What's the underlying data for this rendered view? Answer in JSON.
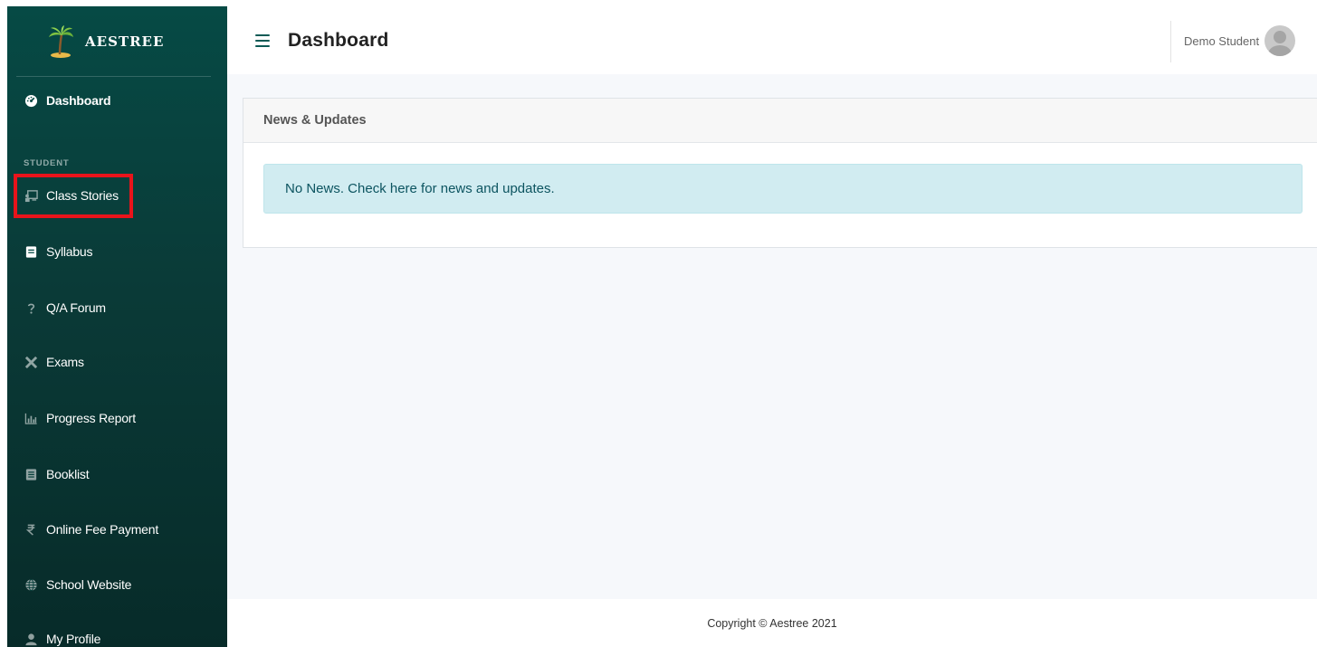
{
  "brand": {
    "name": "AESTREE",
    "logo_icon": "palm-tree-icon"
  },
  "header": {
    "title": "Dashboard",
    "user_name": "Demo Student"
  },
  "sidebar": {
    "section_heading": "STUDENT",
    "items": [
      {
        "label": "Dashboard",
        "icon": "gauge-icon",
        "active": true
      },
      {
        "label": "Class Stories",
        "icon": "chalkboard-teacher-icon"
      },
      {
        "label": "Syllabus",
        "icon": "book-icon"
      },
      {
        "label": "Q/A Forum",
        "icon": "question-icon"
      },
      {
        "label": "Exams",
        "icon": "pencil-ruler-icon"
      },
      {
        "label": "Progress Report",
        "icon": "bar-chart-icon"
      },
      {
        "label": "Booklist",
        "icon": "book-list-icon"
      },
      {
        "label": "Online Fee Payment",
        "icon": "rupee-icon"
      },
      {
        "label": "School Website",
        "icon": "globe-icon"
      },
      {
        "label": "My Profile",
        "icon": "user-icon"
      }
    ]
  },
  "main": {
    "card_title": "News & Updates",
    "alert_text": "No News. Check here for news and updates."
  },
  "footer": {
    "copyright": "Copyright © Aestree 2021"
  },
  "colors": {
    "sidebar_bg": "#064a45",
    "accent": "#0c5a55",
    "alert_bg": "#d1ecf1",
    "alert_text": "#0c5460",
    "highlight": "#e8141b"
  }
}
